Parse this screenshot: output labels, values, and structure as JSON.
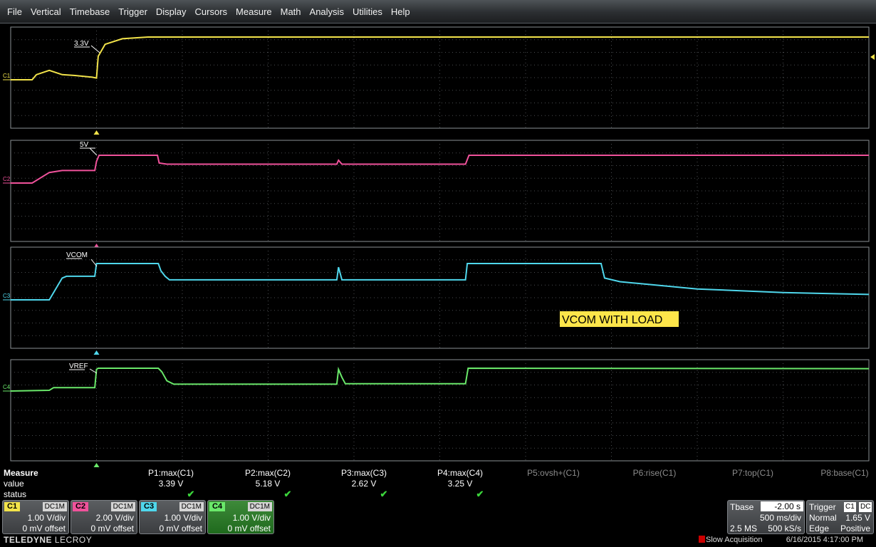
{
  "menu": [
    "File",
    "Vertical",
    "Timebase",
    "Trigger",
    "Display",
    "Cursors",
    "Measure",
    "Math",
    "Analysis",
    "Utilities",
    "Help"
  ],
  "grids": [
    {
      "channel": "C1",
      "color": "#f2e34a",
      "label": "C1",
      "marker": "3.3V",
      "trace": [
        [
          0.0,
          0
        ],
        [
          0.25,
          0
        ],
        [
          0.3,
          0.12
        ],
        [
          0.45,
          0.22
        ],
        [
          0.6,
          0.12
        ],
        [
          0.75,
          0.1
        ],
        [
          0.95,
          0.06
        ],
        [
          1.0,
          0.04
        ],
        [
          1.02,
          0.55
        ],
        [
          1.1,
          0.83
        ],
        [
          1.3,
          0.96
        ],
        [
          1.6,
          1.0
        ],
        [
          10.0,
          1.0
        ]
      ]
    },
    {
      "channel": "C2",
      "color": "#f0529b",
      "label": "C2",
      "marker": "5V",
      "trace": [
        [
          0.0,
          0
        ],
        [
          0.25,
          0
        ],
        [
          0.45,
          0.38
        ],
        [
          0.6,
          0.45
        ],
        [
          0.98,
          0.45
        ],
        [
          1.0,
          0.78
        ],
        [
          1.03,
          1.0
        ],
        [
          1.71,
          1.0
        ],
        [
          1.73,
          0.72
        ],
        [
          1.82,
          0.68
        ],
        [
          3.8,
          0.68
        ],
        [
          3.82,
          0.82
        ],
        [
          3.86,
          0.68
        ],
        [
          5.3,
          0.68
        ],
        [
          5.34,
          1.0
        ],
        [
          10.0,
          1.0
        ]
      ]
    },
    {
      "channel": "C3",
      "color": "#4fd7ec",
      "label": "C3",
      "marker": "VCOM",
      "trace": [
        [
          0.0,
          0
        ],
        [
          0.45,
          0
        ],
        [
          0.6,
          0.6
        ],
        [
          0.65,
          0.65
        ],
        [
          0.98,
          0.65
        ],
        [
          1.0,
          1.0
        ],
        [
          1.72,
          1.0
        ],
        [
          1.75,
          0.8
        ],
        [
          1.8,
          0.65
        ],
        [
          1.85,
          0.55
        ],
        [
          3.8,
          0.55
        ],
        [
          3.82,
          0.9
        ],
        [
          3.86,
          0.55
        ],
        [
          5.3,
          0.55
        ],
        [
          5.32,
          1.0
        ],
        [
          6.88,
          1.0
        ],
        [
          6.92,
          0.6
        ],
        [
          7.1,
          0.5
        ],
        [
          8.0,
          0.3
        ],
        [
          9.0,
          0.2
        ],
        [
          10.0,
          0.15
        ]
      ]
    },
    {
      "channel": "C4",
      "color": "#6ae86a",
      "label": "C4",
      "marker": "VREF",
      "trace": [
        [
          0.0,
          0
        ],
        [
          0.45,
          0.03
        ],
        [
          0.5,
          0.15
        ],
        [
          0.98,
          0.15
        ],
        [
          1.0,
          0.95
        ],
        [
          1.02,
          1.0
        ],
        [
          1.72,
          1.0
        ],
        [
          1.76,
          0.85
        ],
        [
          1.82,
          0.45
        ],
        [
          1.9,
          0.3
        ],
        [
          3.8,
          0.3
        ],
        [
          3.82,
          0.95
        ],
        [
          3.86,
          0.6
        ],
        [
          3.9,
          0.32
        ],
        [
          5.3,
          0.32
        ],
        [
          5.33,
          1.0
        ],
        [
          10.0,
          0.98
        ]
      ]
    }
  ],
  "annotation": "VCOM WITH LOAD",
  "measure": {
    "title": "Measure",
    "rows": [
      "value",
      "status"
    ],
    "params": [
      {
        "name": "P1:max(C1)",
        "value": "3.39 V",
        "ok": "✔",
        "active": true
      },
      {
        "name": "P2:max(C2)",
        "value": "5.18 V",
        "ok": "✔",
        "active": true
      },
      {
        "name": "P3:max(C3)",
        "value": "2.62 V",
        "ok": "✔",
        "active": true
      },
      {
        "name": "P4:max(C4)",
        "value": "3.25 V",
        "ok": "✔",
        "active": true
      },
      {
        "name": "P5:ovsh+(C1)",
        "value": "",
        "ok": "",
        "active": false
      },
      {
        "name": "P6:rise(C1)",
        "value": "",
        "ok": "",
        "active": false
      },
      {
        "name": "P7:top(C1)",
        "value": "",
        "ok": "",
        "active": false
      },
      {
        "name": "P8:base(C1)",
        "value": "",
        "ok": "",
        "active": false
      }
    ]
  },
  "channels": [
    {
      "tag": "C1",
      "coupling": "DC1M",
      "vdiv": "1.00 V/div",
      "offset": "0 mV offset",
      "color": "#f2e34a",
      "tagtext": "#000"
    },
    {
      "tag": "C2",
      "coupling": "DC1M",
      "vdiv": "2.00 V/div",
      "offset": "0 mV offset",
      "color": "#f0529b",
      "tagtext": "#000"
    },
    {
      "tag": "C3",
      "coupling": "DC1M",
      "vdiv": "1.00 V/div",
      "offset": "0 mV offset",
      "color": "#4fd7ec",
      "tagtext": "#000"
    },
    {
      "tag": "C4",
      "coupling": "DC1M",
      "vdiv": "1.00 V/div",
      "offset": "0 mV offset",
      "color": "#6ae86a",
      "tagtext": "#000"
    }
  ],
  "timebase": {
    "label": "Tbase",
    "delay": "-2.00 s",
    "tdiv": "500 ms/div",
    "samples": "2.5 MS",
    "rate": "500 kS/s"
  },
  "trigger": {
    "label": "Trigger",
    "src": "C1",
    "coup": "DC",
    "mode": "Normal",
    "level": "1.65 V",
    "type": "Edge",
    "slope": "Positive"
  },
  "footer": {
    "brand_a": "TELEDYNE",
    "brand_b": "LECROY",
    "acq": "Slow Acquisition",
    "timestamp": "6/16/2015 4:17:00 PM"
  }
}
